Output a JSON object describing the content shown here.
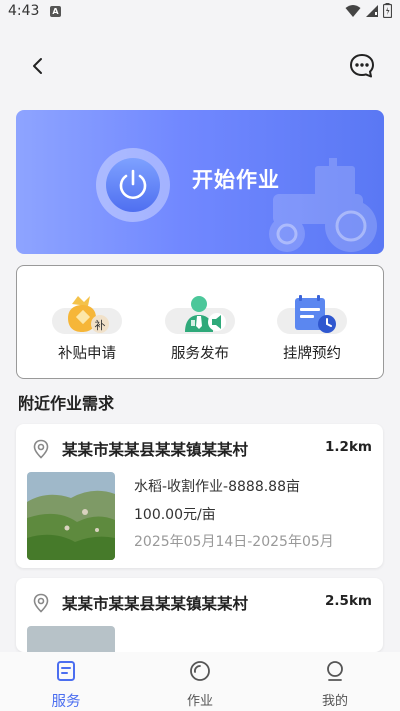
{
  "status_bar": {
    "time": "4:43",
    "notification": "A"
  },
  "banner": {
    "title": "开始作业"
  },
  "services": [
    {
      "label": "补贴申请",
      "badge": "补"
    },
    {
      "label": "服务发布"
    },
    {
      "label": "挂牌预约"
    }
  ],
  "section": {
    "title": "附近作业需求"
  },
  "jobs": [
    {
      "location": "某某市某某县某某镇某某村",
      "distance": "1.2km",
      "task": "水稻-收割作业-8888.88亩",
      "price": "100.00元/亩",
      "date_range": "2025年05月14日-2025年05月"
    },
    {
      "location": "某某市某某县某某镇某某村",
      "distance": "2.5km"
    }
  ],
  "tabs": [
    {
      "label": "服务",
      "active": true
    },
    {
      "label": "作业"
    },
    {
      "label": "我的"
    }
  ],
  "colors": {
    "accent": "#4b6ef0",
    "banner_start": "#8ea4ff",
    "banner_end": "#5a78f4",
    "tab_inactive": "#555555"
  }
}
